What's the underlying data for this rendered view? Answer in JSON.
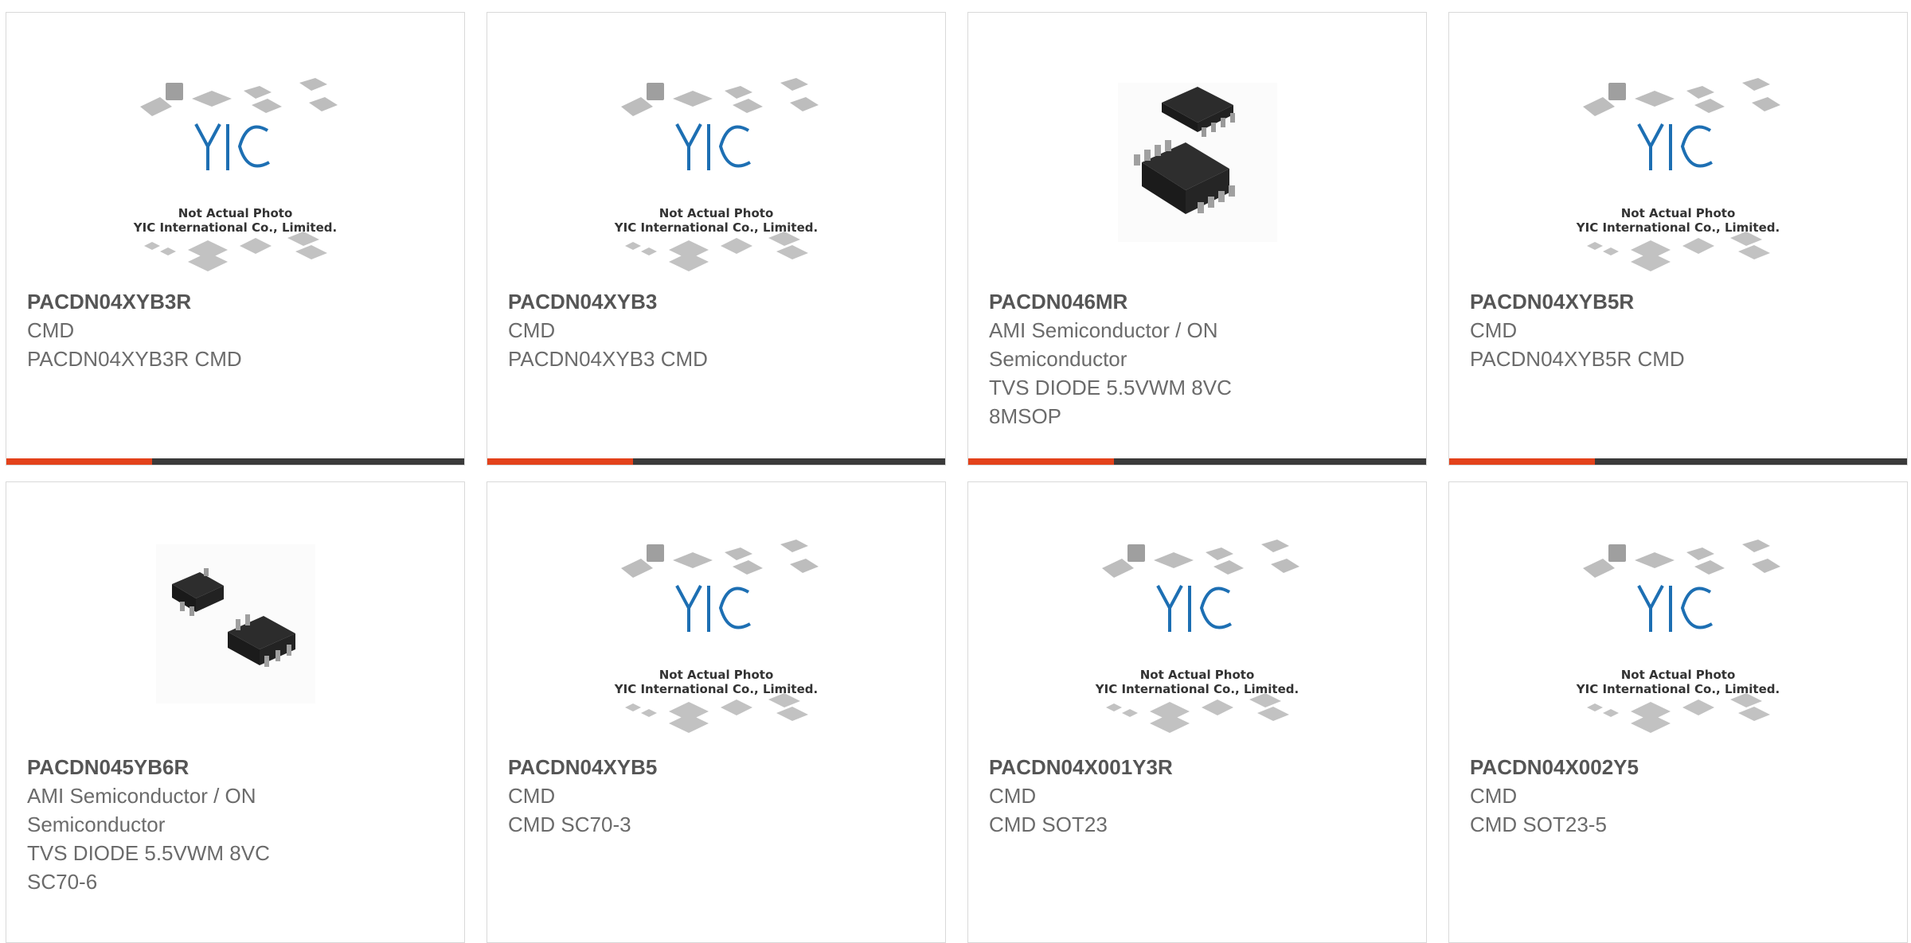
{
  "colors": {
    "accent": "#e3421b",
    "bar": "#3a3a3a",
    "border": "#d9d9d9",
    "logo": "#1d6fb3"
  },
  "placeholder": {
    "line1": "Not Actual Photo",
    "line2": "YIC International Co., Limited.",
    "logo_text": "YIC"
  },
  "products": [
    {
      "part": "PACDN04XYB3R",
      "manufacturer": "CMD",
      "description": "PACDN04XYB3R CMD",
      "image": "placeholder"
    },
    {
      "part": "PACDN04XYB3",
      "manufacturer": "CMD",
      "description": "PACDN04XYB3 CMD",
      "image": "placeholder"
    },
    {
      "part": "PACDN046MR",
      "manufacturer": "AMI Semiconductor / ON Semiconductor",
      "description": "TVS DIODE 5.5VWM 8VC 8MSOP",
      "image": "msop-chip-photo"
    },
    {
      "part": "PACDN04XYB5R",
      "manufacturer": "CMD",
      "description": "PACDN04XYB5R CMD",
      "image": "placeholder"
    },
    {
      "part": "PACDN045YB6R",
      "manufacturer": "AMI Semiconductor / ON Semiconductor",
      "description": "TVS DIODE 5.5VWM 8VC SC70-6",
      "image": "sc70-chip-photo"
    },
    {
      "part": "PACDN04XYB5",
      "manufacturer": "CMD",
      "description": "CMD SC70-3",
      "image": "placeholder"
    },
    {
      "part": "PACDN04X001Y3R",
      "manufacturer": "CMD",
      "description": "CMD SOT23",
      "image": "placeholder"
    },
    {
      "part": "PACDN04X002Y5",
      "manufacturer": "CMD",
      "description": "CMD SOT23-5",
      "image": "placeholder"
    }
  ]
}
